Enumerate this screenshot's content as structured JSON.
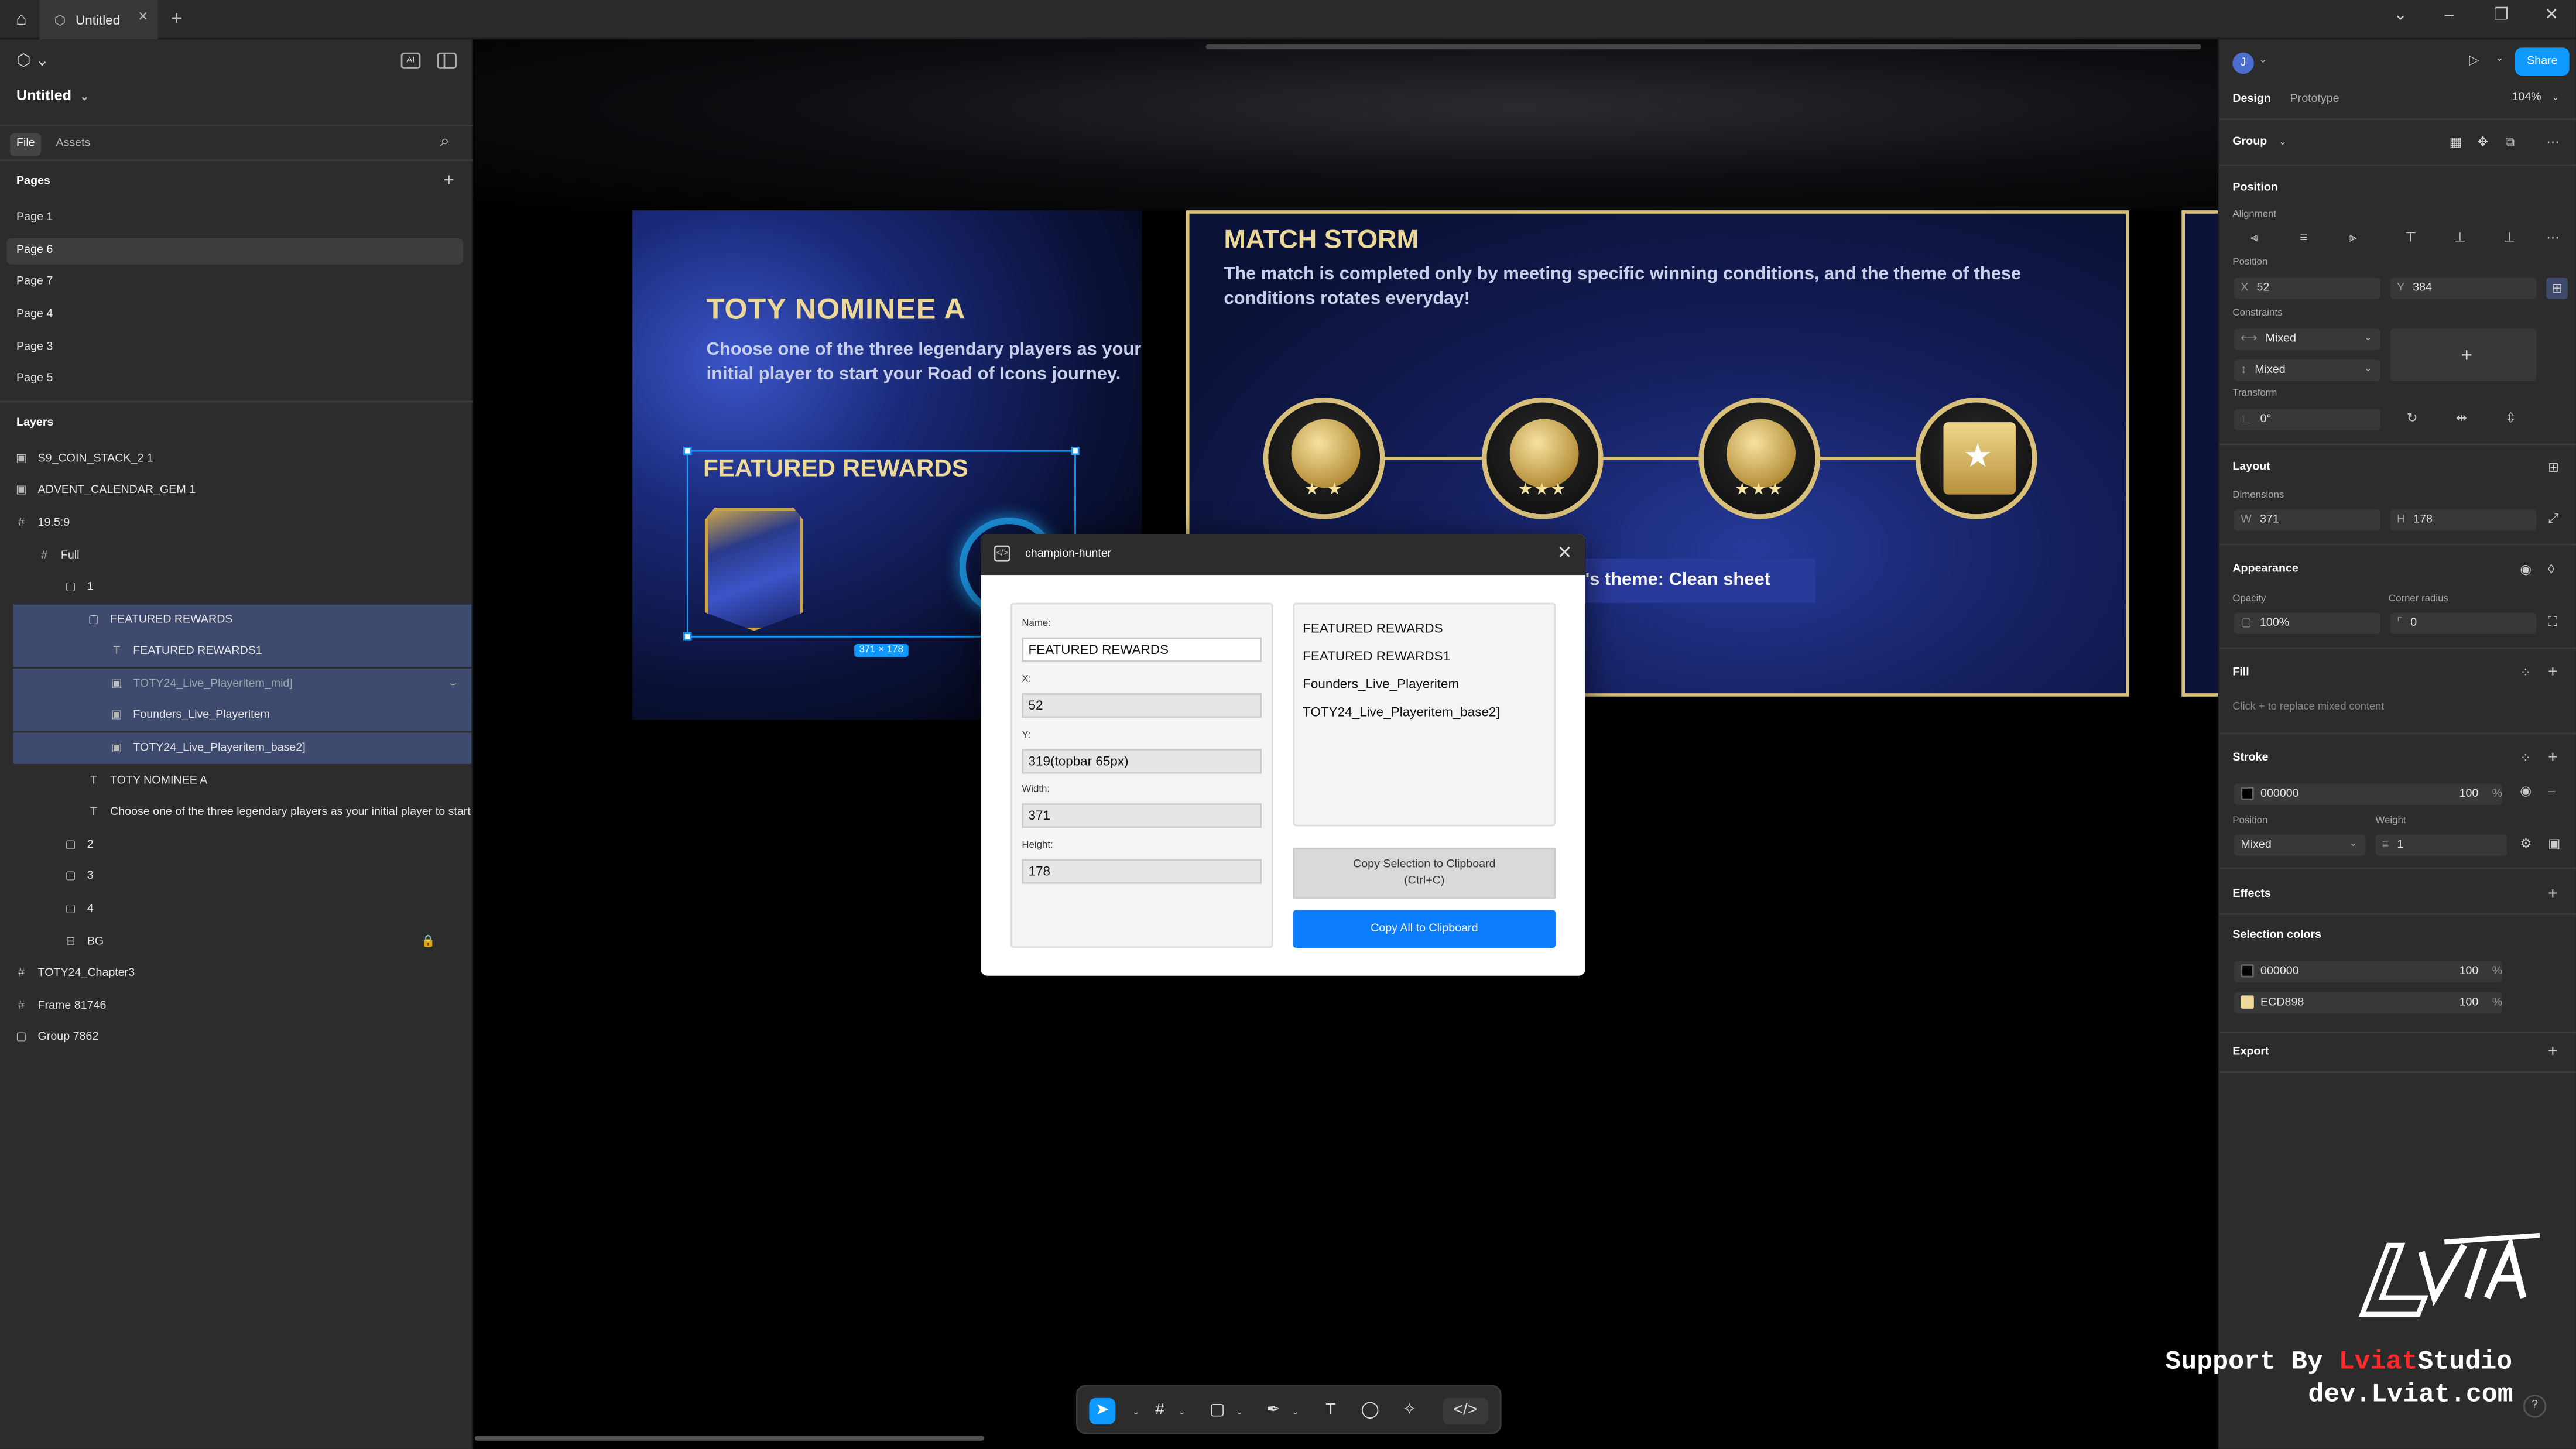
{
  "titlebar": {
    "home_icon": "home-icon",
    "tab_title": "Untitled",
    "tab_close": "×",
    "add_tab": "+",
    "window_controls": [
      "⌄",
      "–",
      "❐",
      "✕"
    ]
  },
  "left_panel": {
    "project_name": "Untitled",
    "file_tab": "File",
    "assets_tab": "Assets",
    "pages_header": "Pages",
    "pages": [
      "Page 1",
      "Page 6",
      "Page 7",
      "Page 4",
      "Page 3",
      "Page 5"
    ],
    "selected_page": "Page 6",
    "layers_header": "Layers",
    "layers": [
      {
        "name": "S9_COIN_STACK_2 1",
        "icon": "▣"
      },
      {
        "name": "ADVENT_CALENDAR_GEM 1",
        "icon": "▣"
      },
      {
        "name": "19.5:9",
        "icon": "#"
      },
      {
        "name": "Full",
        "icon": "#"
      },
      {
        "name": "1",
        "icon": "▢"
      },
      {
        "name": "FEATURED REWARDS",
        "icon": "▢"
      },
      {
        "name": "FEATURED REWARDS1",
        "icon": "T"
      },
      {
        "name": "TOTY24_Live_Playeritem_mid]",
        "icon": "▣"
      },
      {
        "name": "Founders_Live_Playeritem",
        "icon": "▣"
      },
      {
        "name": "TOTY24_Live_Playeritem_base2]",
        "icon": "▣"
      },
      {
        "name": "TOTY NOMINEE A",
        "icon": "T"
      },
      {
        "name": "Choose one of the three legendary players as your initial player to start your Road of Icons journey.",
        "icon": "T"
      },
      {
        "name": "2",
        "icon": "▢"
      },
      {
        "name": "3",
        "icon": "▢"
      },
      {
        "name": "4",
        "icon": "▢"
      },
      {
        "name": "BG",
        "icon": "⊟"
      },
      {
        "name": "TOTY24_Chapter3",
        "icon": "#"
      },
      {
        "name": "Frame 81746",
        "icon": "#"
      },
      {
        "name": "Group 7862",
        "icon": "▢"
      }
    ]
  },
  "right_panel": {
    "avatar_initial": "J",
    "share_label": "Share",
    "design_tab": "Design",
    "prototype_tab": "Prototype",
    "zoom": "104%",
    "selection_type": "Group",
    "position_header": "Position",
    "alignment_label": "Alignment",
    "position_label": "Position",
    "x_label": "X",
    "x_value": "52",
    "y_label": "Y",
    "y_value": "384",
    "constraints_label": "Constraints",
    "constraint_h": "Mixed",
    "constraint_v": "Mixed",
    "transform_label": "Transform",
    "rotation": "0°",
    "layout_header": "Layout",
    "dimensions_label": "Dimensions",
    "w_label": "W",
    "w_value": "371",
    "h_label": "H",
    "h_value": "178",
    "appearance_header": "Appearance",
    "opacity_label": "Opacity",
    "opacity_value": "100%",
    "corner_label": "Corner radius",
    "corner_value": "0",
    "fill_header": "Fill",
    "fill_hint": "Click + to replace mixed content",
    "stroke_header": "Stroke",
    "stroke_color": "000000",
    "stroke_opacity": "100",
    "percent": "%",
    "stroke_position_label": "Position",
    "stroke_weight_label": "Weight",
    "stroke_position": "Mixed",
    "stroke_weight": "1",
    "effects_header": "Effects",
    "selection_colors_header": "Selection colors",
    "selection_colors": [
      {
        "hex": "000000",
        "opacity": "100",
        "swatch": "#000000"
      },
      {
        "hex": "ECD898",
        "opacity": "100",
        "swatch": "#ECD898"
      }
    ],
    "export_header": "Export"
  },
  "canvas": {
    "toty_title": "TOTY NOMINEE A",
    "toty_desc": "Choose one of the three legendary players as your initial player to start your Road of Icons journey.",
    "featured_title": "FEATURED REWARDS",
    "size_tag": "371 × 178",
    "match_title": "MATCH STORM",
    "match_desc": "The match is completed only by meeting specific winning conditions, and the theme of these conditions rotates everyday!",
    "stars": [
      "★ ★",
      "★★★",
      "★★★"
    ],
    "theme_text": "'s theme: Clean sheet"
  },
  "dialog": {
    "title": "champion-hunter",
    "close": "✕",
    "name_label": "Name:",
    "name_value": "FEATURED REWARDS",
    "x_label": "X:",
    "x_value": "52",
    "y_label": "Y:",
    "y_value": "319(topbar 65px)",
    "width_label": "Width:",
    "width_value": "371",
    "height_label": "Height:",
    "height_value": "178",
    "list": [
      "FEATURED REWARDS",
      "FEATURED REWARDS1",
      "Founders_Live_Playeritem",
      "TOTY24_Live_Playeritem_base2]"
    ],
    "copy_selection_label": "Copy Selection to Clipboard",
    "copy_selection_shortcut": "(Ctrl+C)",
    "copy_all_label": "Copy All to Clipboard"
  },
  "toolbar": {
    "tools": [
      "move-icon",
      "frame-icon",
      "rectangle-icon",
      "pen-icon",
      "text-icon",
      "comment-icon",
      "actions-icon",
      "dev-mode-icon"
    ]
  },
  "watermark": {
    "support_prefix": "Support By ",
    "brand_red": "Lviat",
    "brand_white": "Studio",
    "url": "dev.Lviat.com",
    "logo_text": "LVIAT"
  },
  "help": "?"
}
